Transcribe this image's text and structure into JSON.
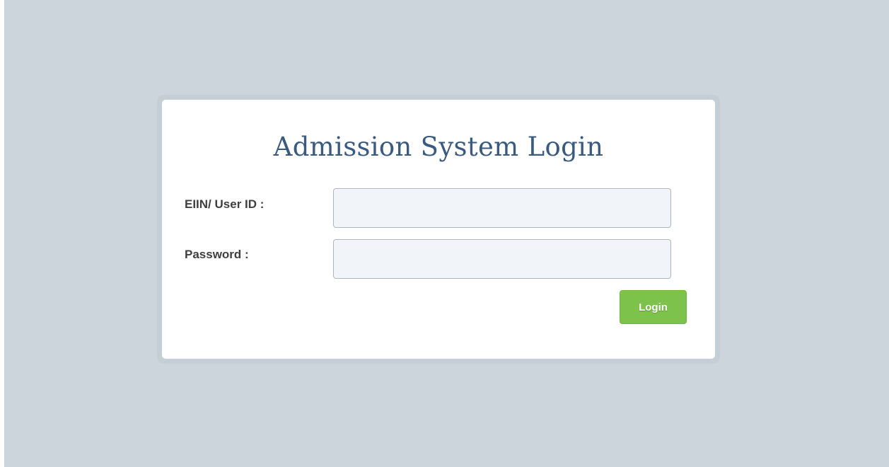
{
  "page": {
    "background_color": "#ccd5dc"
  },
  "login": {
    "title": "Admission System Login",
    "user_id": {
      "label": "EIIN/ User ID :",
      "value": "",
      "placeholder": ""
    },
    "password": {
      "label": "Password :",
      "value": "",
      "placeholder": ""
    },
    "submit_label": "Login",
    "accent_color": "#7dc24a",
    "title_color": "#3a5a7e"
  }
}
